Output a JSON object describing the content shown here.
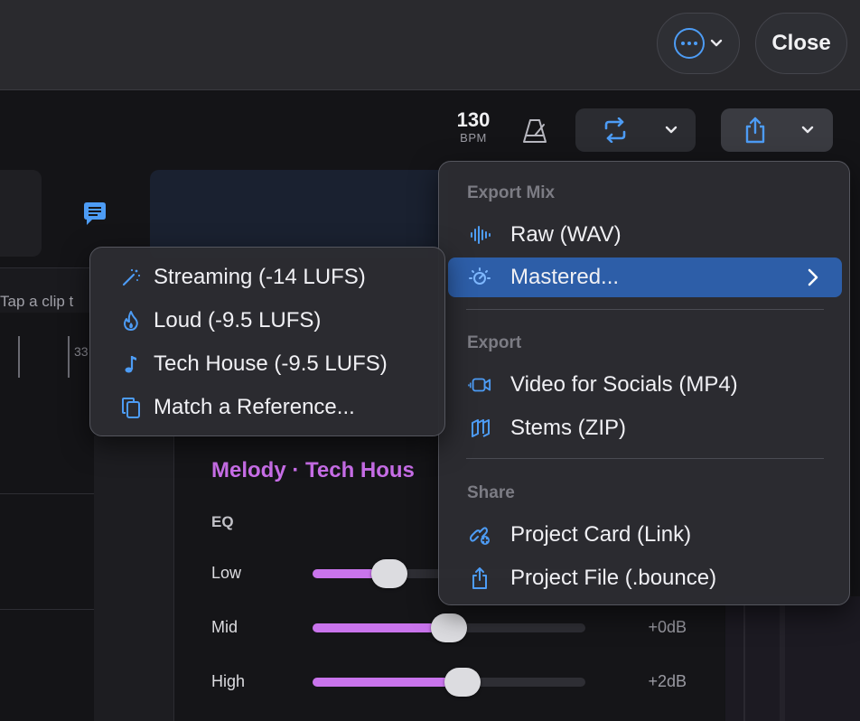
{
  "colors": {
    "accent": "#4d9cf5",
    "highlight": "#2d5ea8",
    "melody": "#c86ee8"
  },
  "header": {
    "more_icon": "ellipsis-circle-icon",
    "close_label": "Close"
  },
  "transport": {
    "bpm_value": "130",
    "bpm_label": "BPM"
  },
  "timeline": {
    "hint": "Tap a clip t",
    "ruler_number": "33"
  },
  "track_panel": {
    "title": "Melody · Tech Hous",
    "eq_label": "EQ",
    "bands": [
      {
        "label": "Low",
        "value": "",
        "level": 0.28
      },
      {
        "label": "Mid",
        "value": "+0dB",
        "level": 0.5
      },
      {
        "label": "High",
        "value": "+2dB",
        "level": 0.55
      }
    ]
  },
  "export_menu": {
    "sections": [
      {
        "title": "Export Mix",
        "items": [
          {
            "label": "Raw (WAV)",
            "icon": "waveform-icon"
          },
          {
            "label": "Mastered...",
            "icon": "sun-dial-icon",
            "active": true
          }
        ]
      },
      {
        "title": "Export",
        "items": [
          {
            "label": "Video for Socials (MP4)",
            "icon": "video-camera-icon"
          },
          {
            "label": "Stems (ZIP)",
            "icon": "stack-icon"
          }
        ]
      },
      {
        "title": "Share",
        "items": [
          {
            "label": "Project Card (Link)",
            "icon": "link-icon"
          },
          {
            "label": "Project File (.bounce)",
            "icon": "share-file-icon"
          }
        ]
      }
    ]
  },
  "mastered_submenu": {
    "items": [
      {
        "label": "Streaming (-14 LUFS)",
        "icon": "magic-wand-icon"
      },
      {
        "label": "Loud (-9.5 LUFS)",
        "icon": "flame-icon"
      },
      {
        "label": "Tech House (-9.5 LUFS)",
        "icon": "music-note-icon"
      },
      {
        "label": "Match a Reference...",
        "icon": "copy-icon"
      }
    ]
  }
}
